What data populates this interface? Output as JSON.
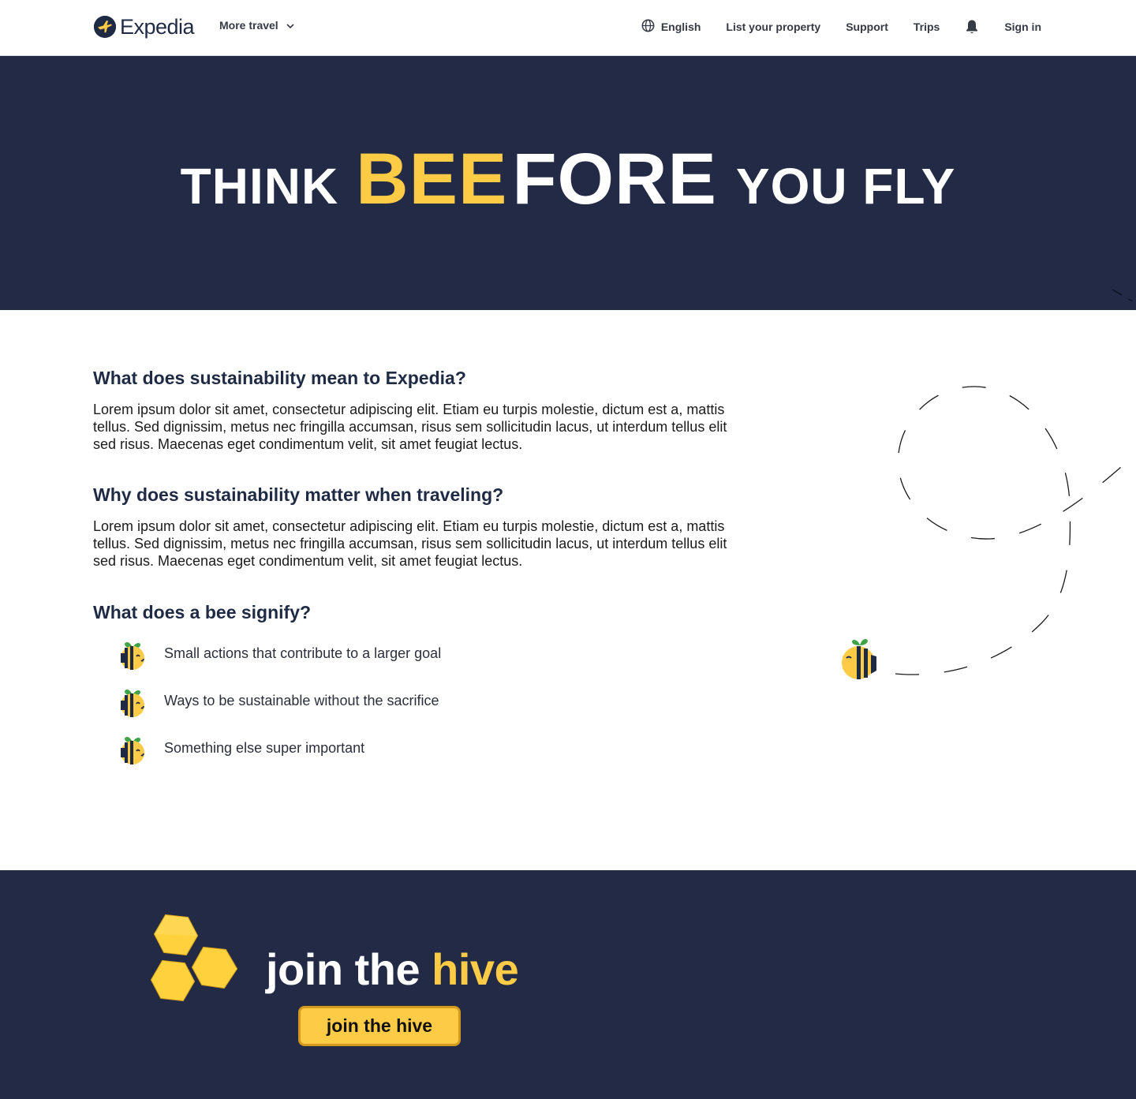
{
  "nav": {
    "logo_text": "Expedia",
    "more_travel": "More travel",
    "language": "English",
    "list_property": "List your property",
    "support": "Support",
    "trips": "Trips",
    "sign_in": "Sign in"
  },
  "hero": {
    "word1": "THINK",
    "word_bee": "BEE",
    "word_fore": "FORE",
    "word3": "YOU FLY"
  },
  "sections": [
    {
      "question": "What does sustainability mean to Expedia?",
      "body": "Lorem ipsum dolor sit amet, consectetur adipiscing elit. Etiam eu turpis molestie, dictum est a, mattis tellus. Sed dignissim, metus nec fringilla accumsan, risus sem sollicitudin lacus, ut interdum tellus elit sed risus. Maecenas eget condimentum velit, sit amet feugiat lectus."
    },
    {
      "question": "Why does sustainability matter when traveling?",
      "body": "Lorem ipsum dolor sit amet, consectetur adipiscing elit. Etiam eu turpis molestie, dictum est a, mattis tellus. Sed dignissim, metus nec fringilla accumsan, risus sem sollicitudin lacus, ut interdum tellus elit sed risus. Maecenas eget condimentum velit, sit amet feugiat lectus."
    }
  ],
  "bee_section": {
    "question": "What does a bee signify?",
    "items": [
      "Small actions that contribute to a larger goal",
      "Ways to be sustainable without the sacrifice",
      "Something else super important"
    ]
  },
  "cta": {
    "title_plain": "join the ",
    "title_highlight": "hive",
    "button": "join the hive"
  },
  "colors": {
    "navy": "#222a46",
    "honey": "#fecb46",
    "leaf": "#3fa447"
  },
  "icons": [
    "expedia-logo-icon",
    "chevron-down-icon",
    "globe-icon",
    "bell-icon",
    "bee-icon",
    "honeycomb-icon"
  ]
}
